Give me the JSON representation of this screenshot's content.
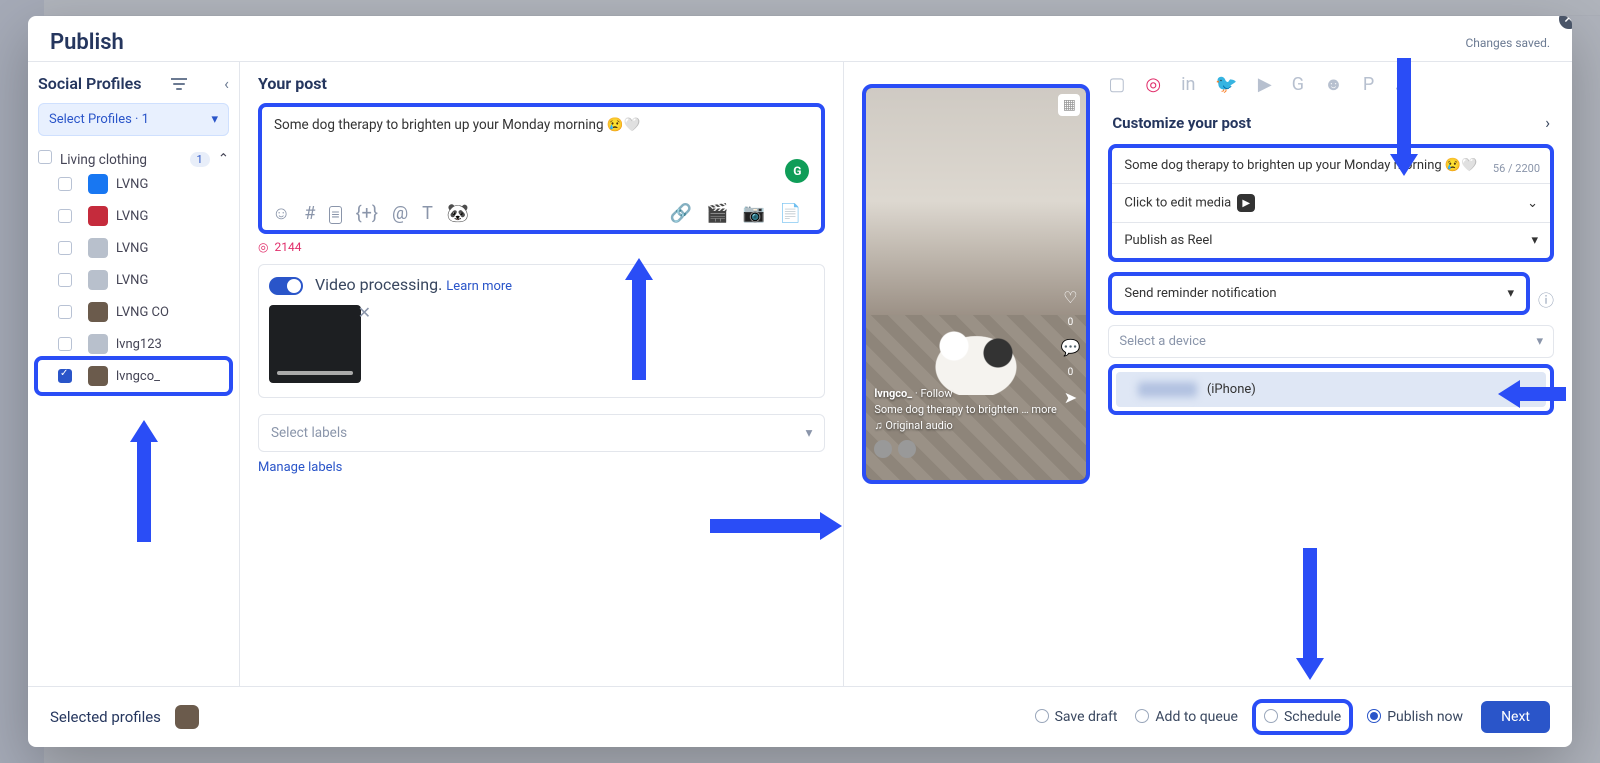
{
  "header": {
    "title": "Publish",
    "saved": "Changes saved."
  },
  "sidebar": {
    "title": "Social Profiles",
    "select_label": "Select Profiles · 1",
    "group": {
      "name": "Living clothing",
      "count": "1"
    },
    "profiles": [
      {
        "label": "LVNG",
        "avatar": "av-fb",
        "checked": false
      },
      {
        "label": "LVNG",
        "avatar": "av-red",
        "checked": false
      },
      {
        "label": "LVNG",
        "avatar": "av-gray",
        "checked": false
      },
      {
        "label": "LVNG",
        "avatar": "av-gray",
        "checked": false
      },
      {
        "label": "LVNG CO",
        "avatar": "av-brn",
        "checked": false
      },
      {
        "label": "lvng123",
        "avatar": "av-gray",
        "checked": false
      },
      {
        "label": "lvngco_",
        "avatar": "av-brn",
        "checked": true,
        "highlight": true
      }
    ]
  },
  "compose": {
    "heading": "Your post",
    "text": "Some dog therapy to brighten up your Monday morning 😢🤍",
    "count": "2144",
    "video_label": "Video processing.",
    "video_link": "Learn more",
    "labels_placeholder": "Select labels",
    "manage": "Manage labels"
  },
  "customize": {
    "heading": "Customize your post",
    "text": "Some dog therapy to brighten up your Monday morning 😢🤍",
    "char_count": "56 / 2200",
    "media_label": "Click to edit media",
    "publish_as": "Publish as Reel",
    "reminder": "Send reminder notification",
    "device_placeholder": "Select a device",
    "device_suffix": "(iPhone)"
  },
  "preview": {
    "handle": "lvngco_",
    "follow": "Follow",
    "caption": "Some dog therapy to brighten",
    "more": "… more",
    "audio": "♫ Original audio",
    "like_count": "0",
    "comment_count": "0"
  },
  "footer": {
    "selected": "Selected profiles",
    "options": [
      {
        "label": "Save draft",
        "key": "save",
        "active": false
      },
      {
        "label": "Add to queue",
        "key": "queue",
        "active": false
      },
      {
        "label": "Schedule",
        "key": "sched",
        "active": false,
        "highlight": true
      },
      {
        "label": "Publish now",
        "key": "now",
        "active": true
      }
    ],
    "next": "Next"
  }
}
